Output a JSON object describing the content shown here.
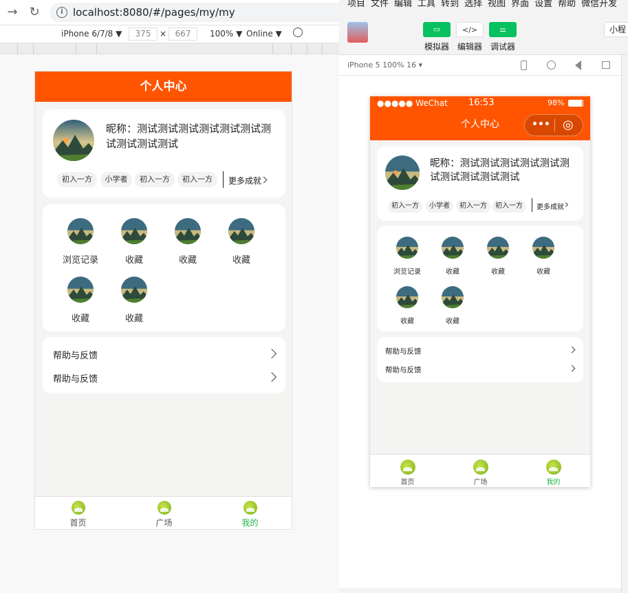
{
  "browser": {
    "url": "localhost:8080/#/pages/my/my",
    "device": "iPhone 6/7/8 ▼",
    "width": "375",
    "height": "667",
    "dim_sep": "×",
    "zoom": "100% ▼",
    "network": "Online ▼"
  },
  "devtools": {
    "menu": [
      "项目",
      "文件",
      "编辑",
      "工具",
      "转到",
      "选择",
      "视图",
      "界面",
      "设置",
      "帮助",
      "微信开发"
    ],
    "toolbar": {
      "simulator": "模拟器",
      "editor": "编辑器",
      "debugger": "调试器",
      "editor_glyph": "</>",
      "miniapp": "小程"
    },
    "sim_info": "iPhone 5 100% 16 ▾",
    "status": {
      "carrier": "●●●●● WeChat",
      "time": "16:53",
      "battery": "98%"
    },
    "capsule": {
      "more": "•••",
      "close": "◎"
    }
  },
  "page": {
    "title": "个人中心",
    "nickname": "昵称：测试测试测试测试测试测试测试测试测试测试",
    "tags": [
      "初入一方",
      "小学者",
      "初入一方",
      "初入一方"
    ],
    "more_achievements": "更多成就",
    "grid": [
      "浏览记录",
      "收藏",
      "收藏",
      "收藏",
      "收藏",
      "收藏"
    ],
    "rows": [
      "帮助与反馈",
      "帮助与反馈"
    ],
    "tabs": [
      "首页",
      "广场",
      "我的"
    ]
  },
  "colors": {
    "primary": "#ff5500",
    "tab_active": "#22b14c",
    "toolbar_green": "#07c160"
  },
  "icons": [
    "back-arrow-icon",
    "reload-icon",
    "info-icon",
    "chevron-right-icon",
    "tab-home-icon",
    "landscape-avatar-icon"
  ]
}
